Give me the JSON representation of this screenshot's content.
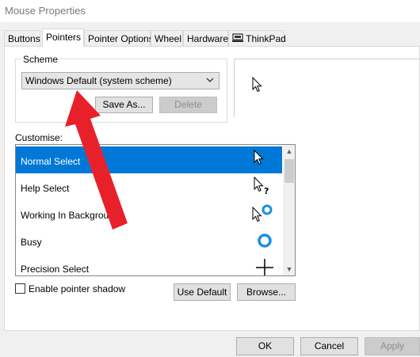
{
  "window": {
    "title": "Mouse Properties"
  },
  "tabs": [
    {
      "label": "Buttons"
    },
    {
      "label": "Pointers",
      "active": true
    },
    {
      "label": "Pointer Options"
    },
    {
      "label": "Wheel"
    },
    {
      "label": "Hardware"
    },
    {
      "label": "ThinkPad"
    }
  ],
  "scheme": {
    "group_label": "Scheme",
    "selected": "Windows Default (system scheme)",
    "save_as_label": "Save As...",
    "delete_label": "Delete"
  },
  "customise": {
    "label": "Customise:",
    "items": [
      {
        "label": "Normal Select",
        "icon": "arrow-cursor-icon",
        "selected": true
      },
      {
        "label": "Help Select",
        "icon": "help-cursor-icon"
      },
      {
        "label": "Working In Background",
        "icon": "working-cursor-icon"
      },
      {
        "label": "Busy",
        "icon": "busy-cursor-icon"
      },
      {
        "label": "Precision Select",
        "icon": "crosshair-cursor-icon"
      }
    ]
  },
  "options": {
    "pointer_shadow_label": "Enable pointer shadow",
    "pointer_shadow_checked": false
  },
  "buttons": {
    "use_default": "Use Default",
    "browse": "Browse...",
    "ok": "OK",
    "cancel": "Cancel",
    "apply": "Apply"
  },
  "colors": {
    "selection": "#0078d7",
    "annotation_arrow": "#e8202a",
    "busy_ring": "#1a8fe3"
  }
}
